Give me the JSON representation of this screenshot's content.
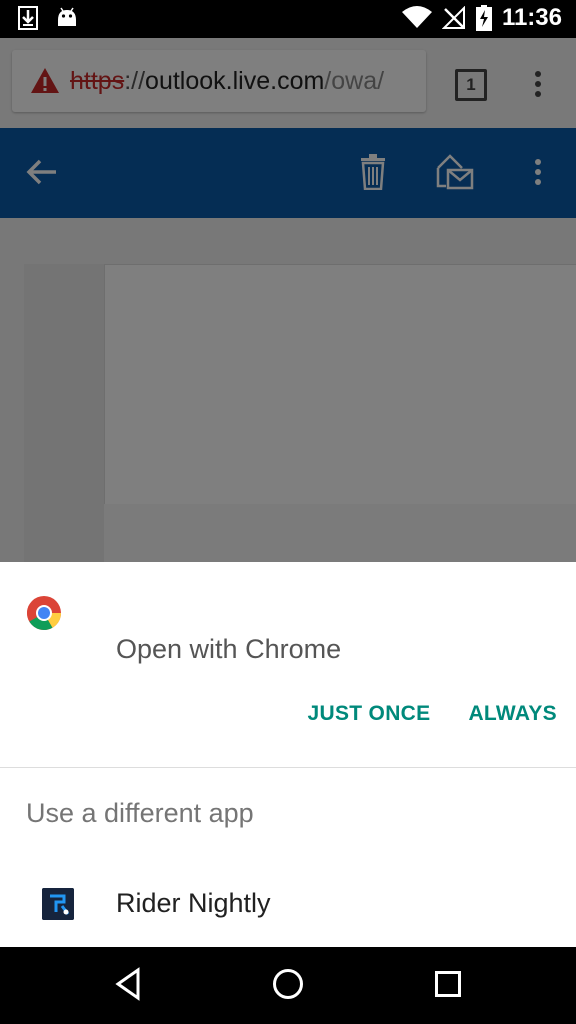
{
  "status_bar": {
    "time": "11:36",
    "icons": [
      "download-icon",
      "android-icon",
      "wifi-icon",
      "no-signal-icon",
      "battery-charging-icon"
    ]
  },
  "browser": {
    "url_scheme": "https",
    "url_separator": "://",
    "url_host": "outlook.live.com",
    "url_path": "/owa/",
    "tab_count": "1"
  },
  "owa_header": {
    "icons": [
      "back-arrow-icon",
      "trash-icon",
      "mark-read-icon",
      "more-vert-icon"
    ],
    "background": "#0b5aa8"
  },
  "chooser": {
    "title": "Open with Chrome",
    "just_once": "JUST ONCE",
    "always": "ALWAYS",
    "different_app_label": "Use a different app",
    "apps": [
      {
        "name": "Rider Nightly"
      }
    ],
    "accent": "#00897b"
  },
  "nav_bar": {
    "icons": [
      "back-icon",
      "home-icon",
      "recents-icon"
    ]
  }
}
